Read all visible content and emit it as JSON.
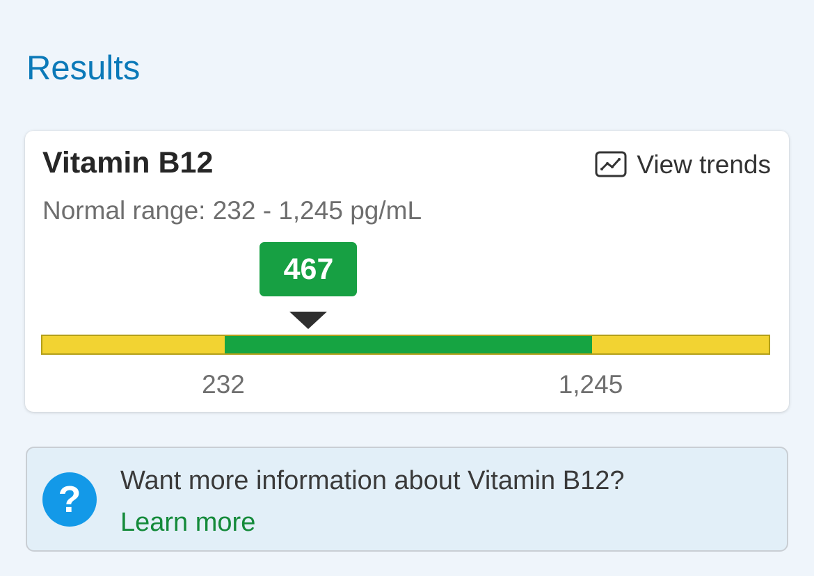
{
  "page": {
    "title": "Results"
  },
  "result": {
    "name": "Vitamin B12",
    "view_trends_label": "View trends",
    "trend_icon": "trend-chart-icon",
    "range_text": "Normal range: 232 - 1,245 pg/mL",
    "value": 467,
    "value_label": "467",
    "normal_low": 232,
    "normal_high": 1245,
    "tick_labels": [
      "232",
      "1,245"
    ],
    "unit": "pg/mL",
    "colors": {
      "normal": "#16a442",
      "out_of_range": "#f2d332",
      "badge": "#17a043",
      "pointer": "#2f2f2f"
    }
  },
  "info": {
    "question": "Want more information about Vitamin B12?",
    "link_label": "Learn more",
    "help_icon": "question-circle-icon",
    "help_glyph": "?"
  }
}
